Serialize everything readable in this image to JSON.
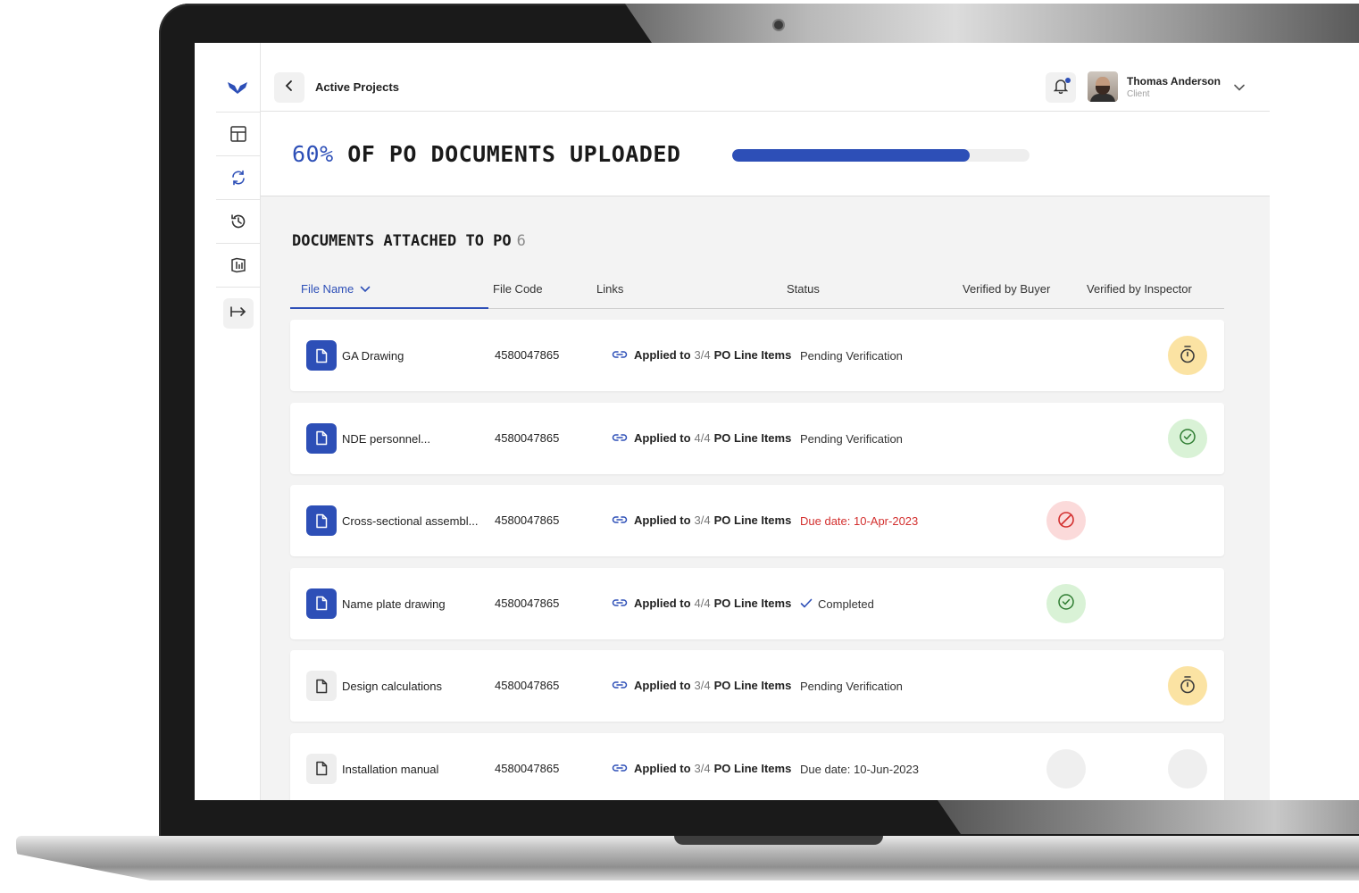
{
  "header": {
    "breadcrumb": "Active Projects",
    "user": {
      "name": "Thomas Anderson",
      "role": "Client"
    }
  },
  "progress": {
    "percent_label": "60%",
    "title": "OF PO DOCUMENTS UPLOADED",
    "value": 0.8
  },
  "section": {
    "title": "DOCUMENTS ATTACHED TO PO",
    "count": "6"
  },
  "columns": {
    "file_name": "File Name",
    "file_code": "File Code",
    "links": "Links",
    "status": "Status",
    "verified_buyer": "Verified by Buyer",
    "verified_inspector": "Verified by Inspector"
  },
  "rows": [
    {
      "name": "GA Drawing",
      "code": "4580047865",
      "link_prefix": "Applied to",
      "link_count": "3/4",
      "link_suffix": "PO Line Items",
      "status": "Pending Verification",
      "status_type": "pending",
      "buyer": "none",
      "inspector": "timer",
      "icon_style": "blue"
    },
    {
      "name": "NDE personnel...",
      "code": "4580047865",
      "link_prefix": "Applied to",
      "link_count": "4/4",
      "link_suffix": "PO Line Items",
      "status": "Pending Verification",
      "status_type": "pending",
      "buyer": "none",
      "inspector": "check",
      "icon_style": "blue"
    },
    {
      "name": "Cross-sectional assembl...",
      "code": "4580047865",
      "link_prefix": "Applied to",
      "link_count": "3/4",
      "link_suffix": "PO Line Items",
      "status": "Due date: 10-Apr-2023",
      "status_type": "overdue",
      "buyer": "rejected",
      "inspector": "none",
      "icon_style": "blue"
    },
    {
      "name": "Name plate drawing",
      "code": "4580047865",
      "link_prefix": "Applied to",
      "link_count": "4/4",
      "link_suffix": "PO Line Items",
      "status": "Completed",
      "status_type": "done",
      "buyer": "check",
      "inspector": "none",
      "icon_style": "blue"
    },
    {
      "name": "Design calculations",
      "code": "4580047865",
      "link_prefix": "Applied to",
      "link_count": "3/4",
      "link_suffix": "PO Line Items",
      "status": "Pending Verification",
      "status_type": "pending",
      "buyer": "none",
      "inspector": "timer",
      "icon_style": "grey"
    },
    {
      "name": "Installation manual",
      "code": "4580047865",
      "link_prefix": "Applied to",
      "link_count": "3/4",
      "link_suffix": "PO Line Items",
      "status": "Due date: 10-Jun-2023",
      "status_type": "pending",
      "buyer": "empty",
      "inspector": "empty",
      "icon_style": "grey"
    }
  ],
  "sidebar": {
    "items": [
      "dashboard-icon",
      "sync-icon",
      "history-icon",
      "reports-icon"
    ]
  },
  "colors": {
    "accent": "#2d4fb7",
    "overdue": "#d3302f",
    "timer_bg": "#fbe3a3",
    "check_bg": "#d9f2d6",
    "reject_bg": "#fbdada"
  }
}
